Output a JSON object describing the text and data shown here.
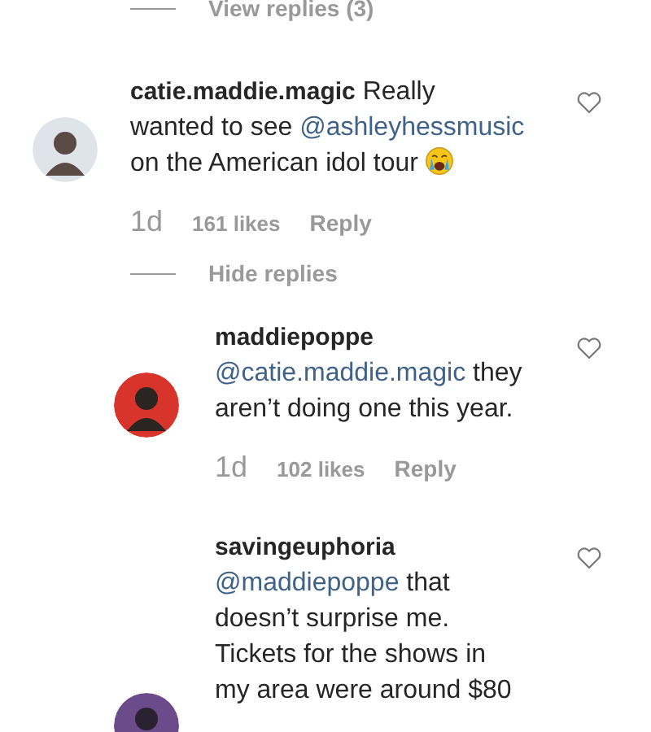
{
  "view_replies": "View replies (3)",
  "comments": [
    {
      "reply": false,
      "liked": false,
      "segments": [
        {
          "kind": "user",
          "text": "catie.maddie.magic"
        },
        {
          "kind": "text",
          "text": " Really\nwanted to see "
        },
        {
          "kind": "mention",
          "text": "@ashleyhessmusic"
        },
        {
          "kind": "text",
          "text": "\non the American idol tour "
        },
        {
          "kind": "emoji"
        }
      ],
      "meta": {
        "age": "1d",
        "likes": "161 likes",
        "reply": "Reply"
      }
    },
    {
      "reply": true,
      "liked": false,
      "segments": [
        {
          "kind": "user",
          "text": "maddiepoppe"
        },
        {
          "kind": "mention",
          "text": "@catie.maddie.magic"
        },
        {
          "kind": "text",
          "text": " they\naren’t doing one this year."
        }
      ],
      "meta": {
        "age": "1d",
        "likes": "102 likes",
        "reply": "Reply"
      }
    },
    {
      "reply": true,
      "liked": false,
      "segments": [
        {
          "kind": "user",
          "text": "savingeuphoria"
        },
        {
          "kind": "mention",
          "text": "@maddiepoppe"
        },
        {
          "kind": "text",
          "text": " that\ndoesn’t surprise me.\nTickets for the shows in\nmy area were around $80"
        }
      ]
    }
  ],
  "hide_replies": "Hide replies"
}
